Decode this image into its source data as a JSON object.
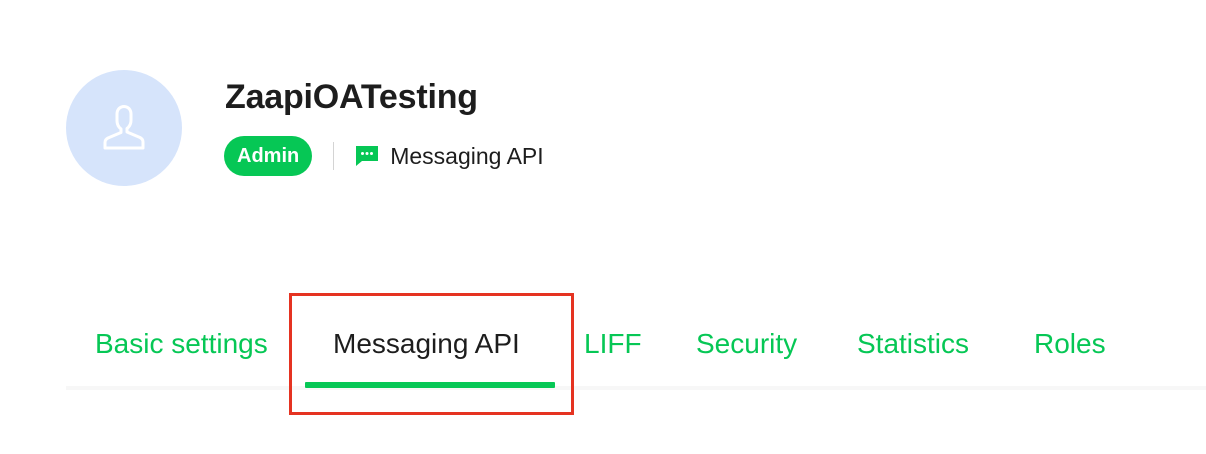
{
  "header": {
    "channel_name": "ZaapiOATesting",
    "role_badge": "Admin",
    "channel_type": "Messaging API",
    "channel_type_icon": "chat-bubble-icon",
    "avatar_icon": "user-silhouette-icon"
  },
  "tabs": [
    {
      "label": "Basic settings",
      "active": false
    },
    {
      "label": "Messaging API",
      "active": true
    },
    {
      "label": "LIFF",
      "active": false
    },
    {
      "label": "Security",
      "active": false
    },
    {
      "label": "Statistics",
      "active": false
    },
    {
      "label": "Roles",
      "active": false
    }
  ],
  "colors": {
    "accent": "#06c755",
    "avatar_bg": "#d6e4fb",
    "text": "#1d1d1d",
    "highlight": "#e53321"
  }
}
